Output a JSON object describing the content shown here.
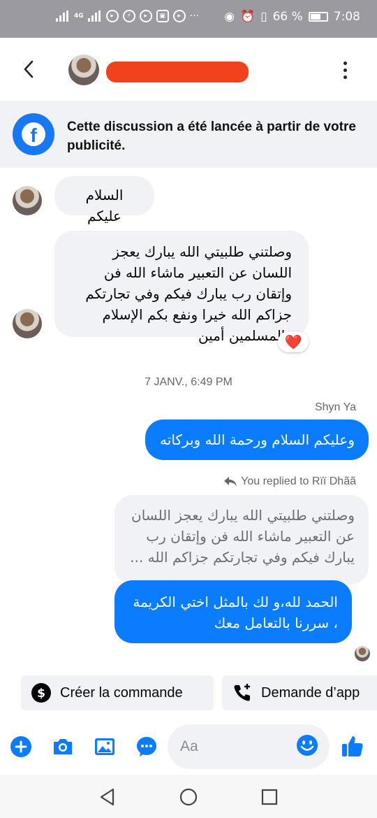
{
  "status_bar": {
    "left_network": "4G",
    "battery_percent": "66 %",
    "battery_level": 0.66,
    "time": "7:08"
  },
  "header": {
    "contact_name": "Rïï Dhãã",
    "icons": [
      "back-arrow-icon",
      "avatar",
      "more-vertical-icon"
    ]
  },
  "banner": {
    "text": "Cette discussion a été lancée à partir de votre publicité.",
    "icon": "facebook-logo-icon",
    "accent": "#1877f2"
  },
  "messages": {
    "in_1": "السلام عليكم",
    "in_2": "وصلتني طلبيتي الله يبارك يعجز اللسان عن التعبير ماشاء الله فن وإتقان رب يبارك فيكم وفي تجارتكم جزاكم الله خيرا ونفع بكم الإسلام والمسلمين أمين",
    "in_2_reaction": "❤️",
    "timestamp": "7 JANV., 6:49 PM",
    "sender_label": "Shyn Ya",
    "out_1": "وعليكم السلام ورحمة الله وبركاته",
    "reply_label": "You replied to Rïï Dhãã",
    "reply_quote": "وصلتني طلبيتي الله يبارك يعجز اللسان عن التعبير ماشاء الله فن وإتقان رب يبارك فيكم وفي تجارتكم جزاكم الله ...",
    "out_2": "الحمد لله،و لك بالمثل اختي الكريمة ، سررنا بالتعامل معك",
    "out_bubble_color": "#0a7cff"
  },
  "quick_actions": {
    "create_order": "Créer la commande",
    "request_call": "Demande d’app"
  },
  "composer": {
    "placeholder": "Aa",
    "icons": [
      "plus-icon",
      "camera-icon",
      "gallery-icon",
      "chat-icon",
      "emoji-icon",
      "thumbs-up-icon"
    ]
  },
  "nav": {
    "icons": [
      "nav-back-icon",
      "nav-home-icon",
      "nav-recents-icon"
    ]
  }
}
